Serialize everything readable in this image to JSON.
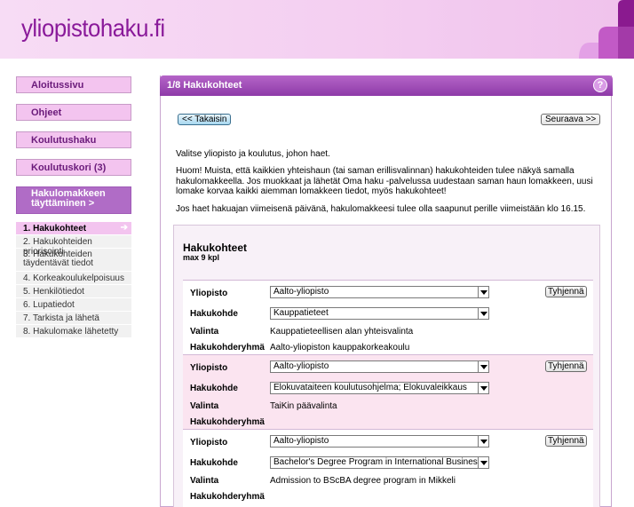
{
  "header": {
    "logo": "yliopistohaku.fi"
  },
  "sidebar": {
    "nav": [
      "Aloitussivu",
      "Ohjeet",
      "Koulutushaku",
      "Koulutuskori (3)"
    ],
    "active": "Hakulomakkeen täyttäminen >",
    "steps": [
      "1. Hakukohteet",
      "2. Hakukohteiden priorisointi",
      "3. Hakukohteiden täydentävät tiedot",
      "4. Korkeakoulukelpoisuus",
      "5. Henkilötiedot",
      "6. Lupatiedot",
      "7. Tarkista ja lähetä",
      "8. Hakulomake lähetetty"
    ],
    "current_arrow": "➔"
  },
  "main": {
    "title": "1/8 Hakukohteet",
    "help": "?",
    "back_label": "<< Takaisin",
    "next_label": "Seuraava >>",
    "intro": "Valitse yliopisto ja koulutus, johon haet.",
    "notice": "Huom! Muista, että kaikkien yhteishaun (tai saman erillisvalinnan) hakukohteiden tulee näkyä samalla hakulomakkeella. Jos muokkaat ja lähetät Oma haku -palvelussa uudestaan saman haun lomakkeen, uusi lomake korvaa kaikki aiemman lomakkeen tiedot, myös hakukohteet!",
    "deadline": "Jos haet hakuajan viimeisenä päivänä, hakulomakkeesi tulee olla saapunut perille viimeistään klo 16.15.",
    "panel": {
      "title": "Hakukohteet",
      "subtitle": "max 9 kpl",
      "labels": {
        "yliopisto": "Yliopisto",
        "hakukohde": "Hakukohde",
        "valinta": "Valinta",
        "ryhma": "Hakukohderyhmä",
        "clear": "Tyhjennä"
      },
      "groups": [
        {
          "yliopisto": "Aalto-yliopisto",
          "hakukohde": "Kauppatieteet",
          "valinta": "Kauppatieteellisen alan yhteisvalinta",
          "ryhma": "Aalto-yliopiston kauppakorkeakoulu"
        },
        {
          "yliopisto": "Aalto-yliopisto",
          "hakukohde": "Elokuvataiteen koulutusohjelma; Elokuvaleikkaus",
          "valinta": "TaiKin päävalinta",
          "ryhma": ""
        },
        {
          "yliopisto": "Aalto-yliopisto",
          "hakukohde": "Bachelor's Degree Program in International Busines",
          "valinta": "Admission to BScBA degree program in Mikkeli",
          "ryhma": ""
        }
      ]
    }
  }
}
